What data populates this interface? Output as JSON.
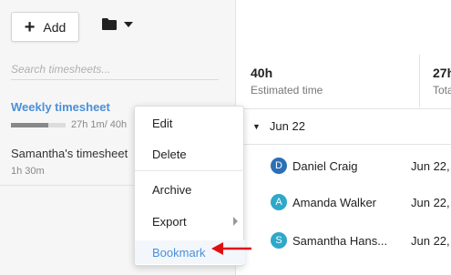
{
  "toolbar": {
    "add_label": "Add",
    "add_icon": "plus-icon",
    "folder_icon": "folder-icon"
  },
  "search": {
    "placeholder": "Search timesheets..."
  },
  "timesheets": [
    {
      "title": "Weekly timesheet",
      "meta": "27h 1m/ 40h",
      "progress": 0.68
    },
    {
      "title": "Samantha's timesheet",
      "meta": "1h 30m"
    }
  ],
  "stats": [
    {
      "value": "40h",
      "label": "Estimated time"
    },
    {
      "value": "27h",
      "label": "Tota"
    }
  ],
  "group": {
    "label": "Jun 22"
  },
  "entries": [
    {
      "initial": "D",
      "name": "Daniel Craig",
      "date": "Jun 22,",
      "color": "#2d6fb5"
    },
    {
      "initial": "A",
      "name": "Amanda Walker",
      "date": "Jun 22,",
      "color": "#2fa8c9"
    },
    {
      "initial": "S",
      "name": "Samantha Hans...",
      "date": "Jun 22,",
      "color": "#2fa8c9"
    }
  ],
  "context_menu": {
    "edit": "Edit",
    "delete": "Delete",
    "archive": "Archive",
    "export": "Export",
    "bookmark": "Bookmark"
  },
  "colors": {
    "accent": "#4a90d9",
    "arrow": "#e01010"
  }
}
